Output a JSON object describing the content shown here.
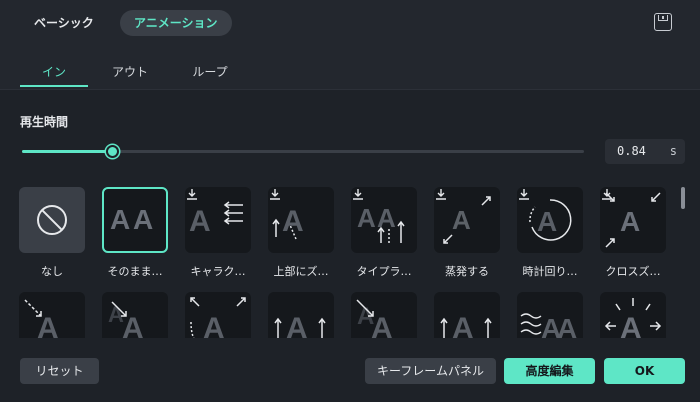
{
  "header": {
    "tabs": [
      {
        "label": "ベーシック",
        "active": false
      },
      {
        "label": "アニメーション",
        "active": true
      }
    ],
    "save_icon": "save-icon"
  },
  "sub_tabs": [
    {
      "label": "イン",
      "active": true
    },
    {
      "label": "アウト",
      "active": false
    },
    {
      "label": "ループ",
      "active": false
    }
  ],
  "duration": {
    "label": "再生時間",
    "value": "0.84",
    "unit": "s",
    "slider_fraction": 0.16
  },
  "presets": {
    "row1": [
      {
        "label": "なし",
        "icon": "none-icon",
        "selected": false,
        "download": false
      },
      {
        "label": "そのまま…",
        "icon": "static-aa-icon",
        "selected": true,
        "download": false
      },
      {
        "label": "キャラク…",
        "icon": "character-slide-icon",
        "selected": false,
        "download": true
      },
      {
        "label": "上部にズ…",
        "icon": "zoom-top-icon",
        "selected": false,
        "download": true
      },
      {
        "label": "タイプラ…",
        "icon": "typewriter-icon",
        "selected": false,
        "download": true
      },
      {
        "label": "蒸発する",
        "icon": "evaporate-icon",
        "selected": false,
        "download": true
      },
      {
        "label": "時計回り…",
        "icon": "clockwise-icon",
        "selected": false,
        "download": true
      },
      {
        "label": "クロスズ…",
        "icon": "cross-zoom-icon",
        "selected": false,
        "download": true
      }
    ],
    "row2": [
      {
        "icon": "diagonal-in-icon"
      },
      {
        "icon": "diagonal-slide-icon"
      },
      {
        "icon": "arc-in-icon"
      },
      {
        "icon": "rise-up-icon"
      },
      {
        "icon": "fall-slide-icon"
      },
      {
        "icon": "rise-up-alt-icon"
      },
      {
        "icon": "wave-icon"
      },
      {
        "icon": "expand-icon"
      }
    ]
  },
  "footer": {
    "reset_label": "リセット",
    "keyframe_label": "キーフレームパネル",
    "advanced_label": "高度編集",
    "ok_label": "OK"
  },
  "colors": {
    "accent": "#5ee6c6",
    "background": "#1e2228",
    "tile": "#15181c"
  }
}
